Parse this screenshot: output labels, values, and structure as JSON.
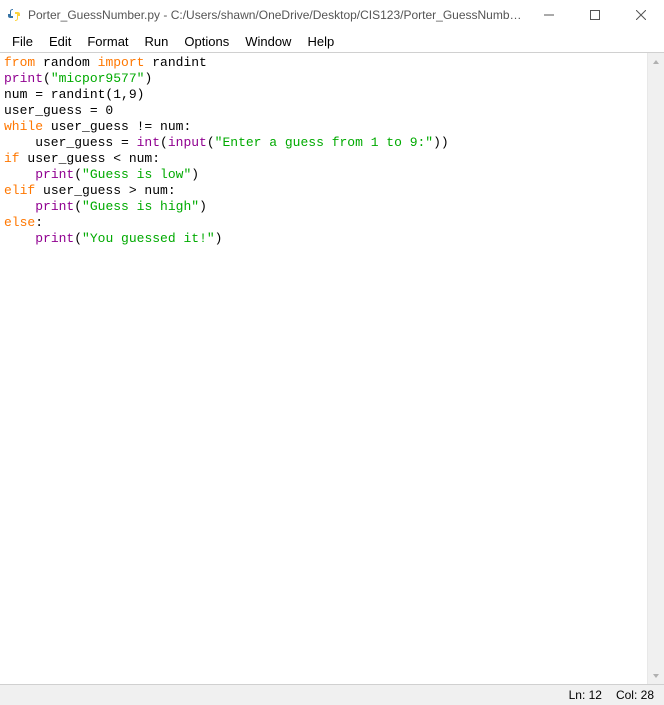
{
  "window": {
    "title": "Porter_GuessNumber.py - C:/Users/shawn/OneDrive/Desktop/CIS123/Porter_GuessNumber.p..."
  },
  "menu": {
    "file": "File",
    "edit": "Edit",
    "format": "Format",
    "run": "Run",
    "options": "Options",
    "window": "Window",
    "help": "Help"
  },
  "code": {
    "lines": [
      {
        "tokens": [
          {
            "c": "kw-orange",
            "t": "from"
          },
          {
            "c": "",
            "t": " random "
          },
          {
            "c": "kw-orange",
            "t": "import"
          },
          {
            "c": "",
            "t": " randint"
          }
        ]
      },
      {
        "tokens": [
          {
            "c": "kw-purple",
            "t": "print"
          },
          {
            "c": "",
            "t": "("
          },
          {
            "c": "str-green",
            "t": "\"micpor9577\""
          },
          {
            "c": "",
            "t": ")"
          }
        ]
      },
      {
        "tokens": [
          {
            "c": "",
            "t": "num = randint(1,9)"
          }
        ]
      },
      {
        "tokens": [
          {
            "c": "",
            "t": "user_guess = 0"
          }
        ]
      },
      {
        "tokens": [
          {
            "c": "kw-orange",
            "t": "while"
          },
          {
            "c": "",
            "t": " user_guess != num:"
          }
        ]
      },
      {
        "tokens": [
          {
            "c": "",
            "t": "    user_guess = "
          },
          {
            "c": "kw-purple",
            "t": "int"
          },
          {
            "c": "",
            "t": "("
          },
          {
            "c": "kw-purple",
            "t": "input"
          },
          {
            "c": "",
            "t": "("
          },
          {
            "c": "str-green",
            "t": "\"Enter a guess from 1 to 9:\""
          },
          {
            "c": "",
            "t": "))"
          }
        ]
      },
      {
        "tokens": [
          {
            "c": "kw-orange",
            "t": "if"
          },
          {
            "c": "",
            "t": " user_guess < num:"
          }
        ]
      },
      {
        "tokens": [
          {
            "c": "",
            "t": "    "
          },
          {
            "c": "kw-purple",
            "t": "print"
          },
          {
            "c": "",
            "t": "("
          },
          {
            "c": "str-green",
            "t": "\"Guess is low\""
          },
          {
            "c": "",
            "t": ")"
          }
        ]
      },
      {
        "tokens": [
          {
            "c": "kw-orange",
            "t": "elif"
          },
          {
            "c": "",
            "t": " user_guess > num:"
          }
        ]
      },
      {
        "tokens": [
          {
            "c": "",
            "t": "    "
          },
          {
            "c": "kw-purple",
            "t": "print"
          },
          {
            "c": "",
            "t": "("
          },
          {
            "c": "str-green",
            "t": "\"Guess is high\""
          },
          {
            "c": "",
            "t": ")"
          }
        ]
      },
      {
        "tokens": [
          {
            "c": "kw-orange",
            "t": "else"
          },
          {
            "c": "",
            "t": ":"
          }
        ]
      },
      {
        "tokens": [
          {
            "c": "",
            "t": "    "
          },
          {
            "c": "kw-purple",
            "t": "print"
          },
          {
            "c": "",
            "t": "("
          },
          {
            "c": "str-green",
            "t": "\"You guessed it!\""
          },
          {
            "c": "",
            "t": ")"
          }
        ]
      }
    ]
  },
  "status": {
    "line_label": "Ln: 12",
    "col_label": "Col: 28"
  }
}
